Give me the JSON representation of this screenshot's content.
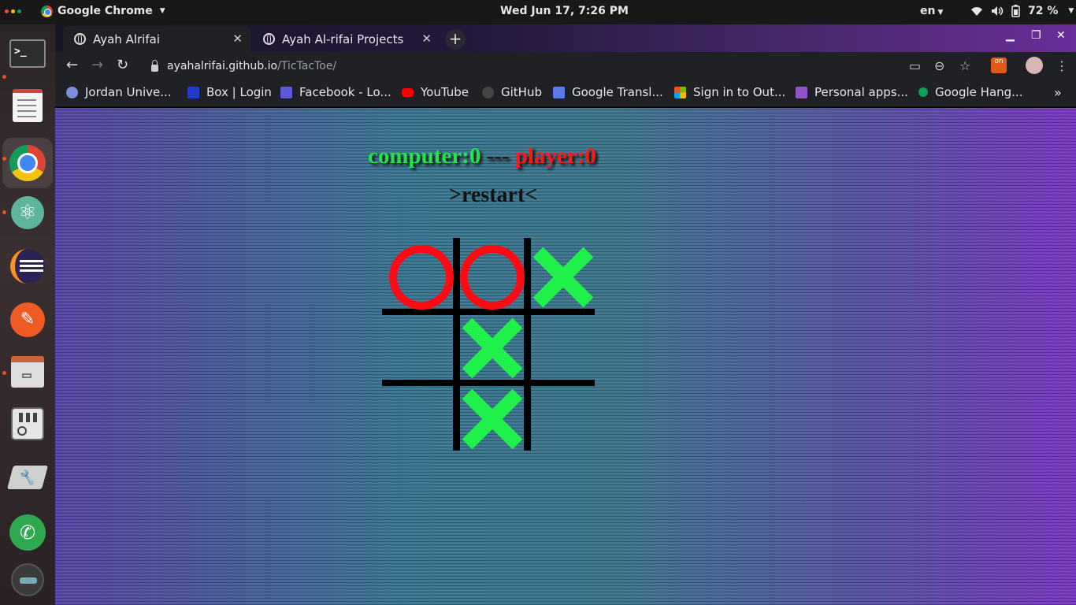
{
  "system": {
    "app_name": "Google Chrome",
    "clock": "Wed Jun 17,  7:26 PM",
    "language": "en",
    "battery": "72 %"
  },
  "tabs": [
    {
      "title": "Ayah Alrifai",
      "active": true
    },
    {
      "title": "Ayah Al-rifai Projects",
      "active": false
    }
  ],
  "address": {
    "host": "ayahalrifai.github.io",
    "path": "/TicTacToe/"
  },
  "bookmarks": [
    {
      "label": "Jordan Unive...",
      "icon": "jordan-uni-icon",
      "color": "#7a8fd8"
    },
    {
      "label": "Box | Login",
      "icon": "box-icon",
      "color": "#1e3cc8"
    },
    {
      "label": "Facebook - Lo...",
      "icon": "facebook-icon",
      "color": "#5b5bd6"
    },
    {
      "label": "YouTube",
      "icon": "youtube-icon",
      "color": "#ff0000"
    },
    {
      "label": "GitHub",
      "icon": "github-icon",
      "color": "#444444"
    },
    {
      "label": "Google Transl...",
      "icon": "translate-icon",
      "color": "#5b7be8"
    },
    {
      "label": "Sign in to Out...",
      "icon": "microsoft-icon",
      "color": "#f25022"
    },
    {
      "label": "Personal apps...",
      "icon": "heroku-icon",
      "color": "#8e54c8"
    },
    {
      "label": "Google Hang...",
      "icon": "hangouts-icon",
      "color": "#0f9d58"
    }
  ],
  "game": {
    "computer_label": "computer:0",
    "separator": "---",
    "player_label": "player:0",
    "restart_label": ">restart<",
    "board": [
      "O",
      "O",
      "X",
      "",
      "X",
      "",
      "",
      "X",
      ""
    ],
    "colors": {
      "o": "#ff0a14",
      "x": "#1ff04a",
      "grid": "#000000"
    }
  },
  "dock": [
    "terminal-icon",
    "text-editor-icon",
    "chrome-icon",
    "atom-icon",
    "eclipse-icon",
    "postman-icon",
    "file-cabinet-icon",
    "mixer-icon",
    "settings-tools-icon",
    "phone-icon",
    "avatar-icon"
  ]
}
